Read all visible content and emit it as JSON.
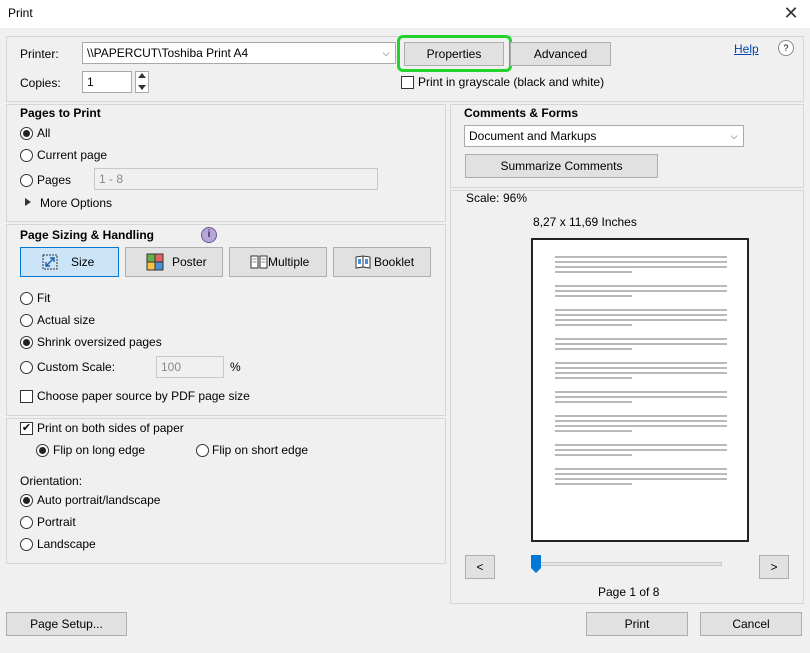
{
  "window": {
    "title": "Print",
    "close_label": "✕"
  },
  "printer": {
    "label": "Printer:",
    "value": "\\\\PAPERCUT\\Toshiba Print A4",
    "properties_label": "Properties",
    "advanced_label": "Advanced",
    "help_label": "Help",
    "copies_label": "Copies:",
    "copies_value": "1",
    "grayscale_label": "Print in grayscale (black and white)"
  },
  "pages_to_print": {
    "heading": "Pages to Print",
    "all_label": "All",
    "current_label": "Current page",
    "pages_label": "Pages",
    "pages_value": "1 - 8",
    "more_options_label": "More Options"
  },
  "sizing": {
    "heading": "Page Sizing & Handling",
    "info_icon": "i",
    "size_label": "Size",
    "poster_label": "Poster",
    "multiple_label": "Multiple",
    "booklet_label": "Booklet",
    "fit_label": "Fit",
    "actual_label": "Actual size",
    "shrink_label": "Shrink oversized pages",
    "custom_label": "Custom Scale:",
    "custom_value": "100",
    "percent": "%",
    "paper_source_label": "Choose paper source by PDF page size"
  },
  "duplex": {
    "both_sides_label": "Print on both sides of paper",
    "long_edge_label": "Flip on long edge",
    "short_edge_label": "Flip on short edge"
  },
  "orientation": {
    "heading": "Orientation:",
    "auto_label": "Auto portrait/landscape",
    "portrait_label": "Portrait",
    "landscape_label": "Landscape"
  },
  "comments": {
    "heading": "Comments & Forms",
    "value": "Document and Markups",
    "summarize_label": "Summarize Comments"
  },
  "preview": {
    "scale_label": "Scale:",
    "scale_value": "96%",
    "page_size": "8,27 x 11,69 Inches",
    "prev_label": "<",
    "next_label": ">",
    "page_status": "Page 1 of 8",
    "slider_position": 0
  },
  "footer": {
    "page_setup_label": "Page Setup...",
    "print_label": "Print",
    "cancel_label": "Cancel"
  }
}
